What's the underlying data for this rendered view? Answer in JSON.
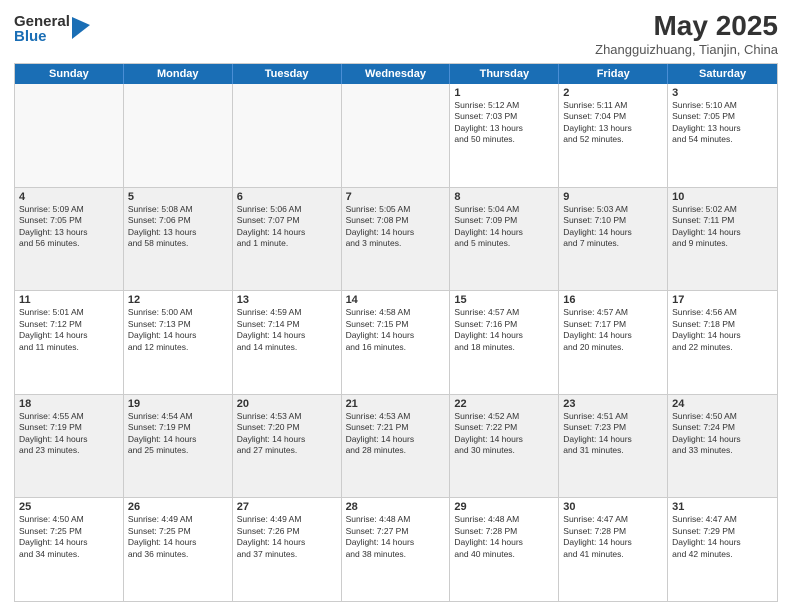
{
  "logo": {
    "general": "General",
    "blue": "Blue"
  },
  "title": {
    "month_year": "May 2025",
    "location": "Zhangguizhuang, Tianjin, China"
  },
  "calendar": {
    "headers": [
      "Sunday",
      "Monday",
      "Tuesday",
      "Wednesday",
      "Thursday",
      "Friday",
      "Saturday"
    ],
    "rows": [
      [
        {
          "day": "",
          "text": "",
          "empty": true
        },
        {
          "day": "",
          "text": "",
          "empty": true
        },
        {
          "day": "",
          "text": "",
          "empty": true
        },
        {
          "day": "",
          "text": "",
          "empty": true
        },
        {
          "day": "1",
          "text": "Sunrise: 5:12 AM\nSunset: 7:03 PM\nDaylight: 13 hours\nand 50 minutes.",
          "empty": false
        },
        {
          "day": "2",
          "text": "Sunrise: 5:11 AM\nSunset: 7:04 PM\nDaylight: 13 hours\nand 52 minutes.",
          "empty": false
        },
        {
          "day": "3",
          "text": "Sunrise: 5:10 AM\nSunset: 7:05 PM\nDaylight: 13 hours\nand 54 minutes.",
          "empty": false
        }
      ],
      [
        {
          "day": "4",
          "text": "Sunrise: 5:09 AM\nSunset: 7:05 PM\nDaylight: 13 hours\nand 56 minutes.",
          "empty": false
        },
        {
          "day": "5",
          "text": "Sunrise: 5:08 AM\nSunset: 7:06 PM\nDaylight: 13 hours\nand 58 minutes.",
          "empty": false
        },
        {
          "day": "6",
          "text": "Sunrise: 5:06 AM\nSunset: 7:07 PM\nDaylight: 14 hours\nand 1 minute.",
          "empty": false
        },
        {
          "day": "7",
          "text": "Sunrise: 5:05 AM\nSunset: 7:08 PM\nDaylight: 14 hours\nand 3 minutes.",
          "empty": false
        },
        {
          "day": "8",
          "text": "Sunrise: 5:04 AM\nSunset: 7:09 PM\nDaylight: 14 hours\nand 5 minutes.",
          "empty": false
        },
        {
          "day": "9",
          "text": "Sunrise: 5:03 AM\nSunset: 7:10 PM\nDaylight: 14 hours\nand 7 minutes.",
          "empty": false
        },
        {
          "day": "10",
          "text": "Sunrise: 5:02 AM\nSunset: 7:11 PM\nDaylight: 14 hours\nand 9 minutes.",
          "empty": false
        }
      ],
      [
        {
          "day": "11",
          "text": "Sunrise: 5:01 AM\nSunset: 7:12 PM\nDaylight: 14 hours\nand 11 minutes.",
          "empty": false
        },
        {
          "day": "12",
          "text": "Sunrise: 5:00 AM\nSunset: 7:13 PM\nDaylight: 14 hours\nand 12 minutes.",
          "empty": false
        },
        {
          "day": "13",
          "text": "Sunrise: 4:59 AM\nSunset: 7:14 PM\nDaylight: 14 hours\nand 14 minutes.",
          "empty": false
        },
        {
          "day": "14",
          "text": "Sunrise: 4:58 AM\nSunset: 7:15 PM\nDaylight: 14 hours\nand 16 minutes.",
          "empty": false
        },
        {
          "day": "15",
          "text": "Sunrise: 4:57 AM\nSunset: 7:16 PM\nDaylight: 14 hours\nand 18 minutes.",
          "empty": false
        },
        {
          "day": "16",
          "text": "Sunrise: 4:57 AM\nSunset: 7:17 PM\nDaylight: 14 hours\nand 20 minutes.",
          "empty": false
        },
        {
          "day": "17",
          "text": "Sunrise: 4:56 AM\nSunset: 7:18 PM\nDaylight: 14 hours\nand 22 minutes.",
          "empty": false
        }
      ],
      [
        {
          "day": "18",
          "text": "Sunrise: 4:55 AM\nSunset: 7:19 PM\nDaylight: 14 hours\nand 23 minutes.",
          "empty": false
        },
        {
          "day": "19",
          "text": "Sunrise: 4:54 AM\nSunset: 7:19 PM\nDaylight: 14 hours\nand 25 minutes.",
          "empty": false
        },
        {
          "day": "20",
          "text": "Sunrise: 4:53 AM\nSunset: 7:20 PM\nDaylight: 14 hours\nand 27 minutes.",
          "empty": false
        },
        {
          "day": "21",
          "text": "Sunrise: 4:53 AM\nSunset: 7:21 PM\nDaylight: 14 hours\nand 28 minutes.",
          "empty": false
        },
        {
          "day": "22",
          "text": "Sunrise: 4:52 AM\nSunset: 7:22 PM\nDaylight: 14 hours\nand 30 minutes.",
          "empty": false
        },
        {
          "day": "23",
          "text": "Sunrise: 4:51 AM\nSunset: 7:23 PM\nDaylight: 14 hours\nand 31 minutes.",
          "empty": false
        },
        {
          "day": "24",
          "text": "Sunrise: 4:50 AM\nSunset: 7:24 PM\nDaylight: 14 hours\nand 33 minutes.",
          "empty": false
        }
      ],
      [
        {
          "day": "25",
          "text": "Sunrise: 4:50 AM\nSunset: 7:25 PM\nDaylight: 14 hours\nand 34 minutes.",
          "empty": false
        },
        {
          "day": "26",
          "text": "Sunrise: 4:49 AM\nSunset: 7:25 PM\nDaylight: 14 hours\nand 36 minutes.",
          "empty": false
        },
        {
          "day": "27",
          "text": "Sunrise: 4:49 AM\nSunset: 7:26 PM\nDaylight: 14 hours\nand 37 minutes.",
          "empty": false
        },
        {
          "day": "28",
          "text": "Sunrise: 4:48 AM\nSunset: 7:27 PM\nDaylight: 14 hours\nand 38 minutes.",
          "empty": false
        },
        {
          "day": "29",
          "text": "Sunrise: 4:48 AM\nSunset: 7:28 PM\nDaylight: 14 hours\nand 40 minutes.",
          "empty": false
        },
        {
          "day": "30",
          "text": "Sunrise: 4:47 AM\nSunset: 7:28 PM\nDaylight: 14 hours\nand 41 minutes.",
          "empty": false
        },
        {
          "day": "31",
          "text": "Sunrise: 4:47 AM\nSunset: 7:29 PM\nDaylight: 14 hours\nand 42 minutes.",
          "empty": false
        }
      ]
    ]
  }
}
